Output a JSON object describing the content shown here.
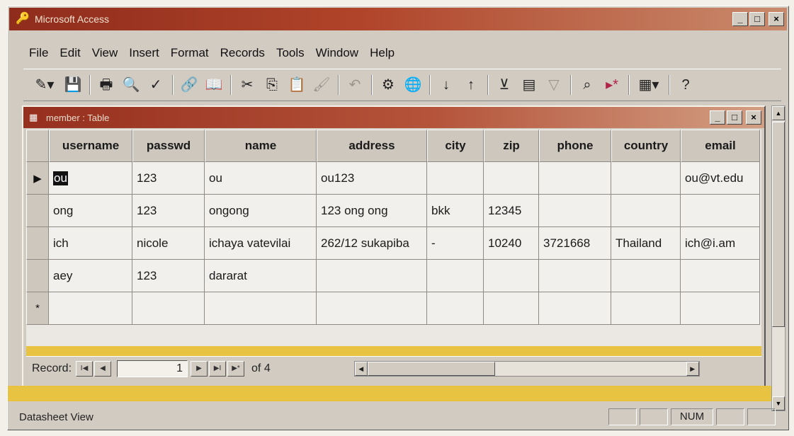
{
  "app": {
    "title": "Microsoft Access",
    "min": "_",
    "max": "□",
    "close": "×"
  },
  "menu": [
    "File",
    "Edit",
    "View",
    "Insert",
    "Format",
    "Records",
    "Tools",
    "Window",
    "Help"
  ],
  "toolbar_icons": [
    "design-view-icon",
    "save-icon",
    "print-icon",
    "print-preview-icon",
    "spelling-icon",
    "insert-hyperlink-icon",
    "web-toolbar-icon",
    "cut-icon",
    "copy-icon",
    "paste-icon",
    "format-painter-icon",
    "undo-icon",
    "relationships-icon",
    "analyze-icon",
    "sort-ascending-icon",
    "sort-descending-icon",
    "filter-by-selection-icon",
    "filter-by-form-icon",
    "apply-filter-icon",
    "find-icon",
    "new-record-icon",
    "database-window-icon",
    "help-icon"
  ],
  "table_window": {
    "title": "member : Table",
    "columns": [
      "username",
      "passwd",
      "name",
      "address",
      "city",
      "zip",
      "phone",
      "country",
      "email"
    ],
    "rows": [
      {
        "selector": "▶",
        "cells": [
          "ou",
          "123",
          "ou",
          "ou123",
          "",
          "",
          "",
          "",
          "ou@vt.edu"
        ]
      },
      {
        "selector": "",
        "cells": [
          "ong",
          "123",
          "ongong",
          "123 ong ong",
          "bkk",
          "12345",
          "",
          "",
          ""
        ]
      },
      {
        "selector": "",
        "cells": [
          "ich",
          "nicole",
          "ichaya vatevilai",
          "262/12 sukapiba",
          "-",
          "10240",
          "3721668",
          "Thailand",
          "ich@i.am"
        ]
      },
      {
        "selector": "",
        "cells": [
          "aey",
          "123",
          "dararat",
          "",
          "",
          "",
          "",
          "",
          ""
        ]
      },
      {
        "selector": "*",
        "cells": [
          "",
          "",
          "",
          "",
          "",
          "",
          "",
          "",
          ""
        ]
      }
    ]
  },
  "navigation": {
    "label": "Record:",
    "current": "1",
    "of_text": "of 4",
    "btn_first": "I◀",
    "btn_prev": "◀",
    "btn_next": "▶",
    "btn_last": "▶I",
    "btn_new": "▶*"
  },
  "status": {
    "text": "Datasheet View",
    "num": "NUM"
  },
  "colors": {
    "titlebar": "#a33a25",
    "highlight_band": "#e8c341"
  }
}
